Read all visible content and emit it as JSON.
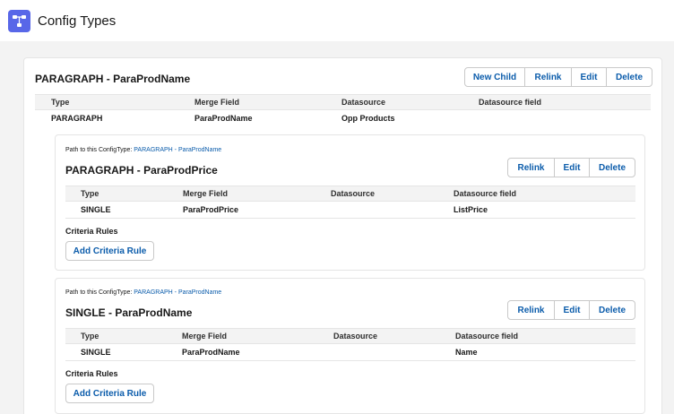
{
  "app": {
    "title": "Config Types",
    "icon": "hierarchy-icon",
    "icon_color": "#5867e8"
  },
  "accent": "#0b5cab",
  "main": {
    "title": "PARAGRAPH - ParaProdName",
    "buttons": {
      "new_child": "New Child",
      "relink": "Relink",
      "edit": "Edit",
      "delete": "Delete"
    },
    "columns": [
      "Type",
      "Merge Field",
      "Datasource",
      "Datasource field"
    ],
    "row": [
      "PARAGRAPH",
      "ParaProdName",
      "Opp Products",
      ""
    ]
  },
  "children": [
    {
      "path_label": "Path to this ConfigType:",
      "path_link": "PARAGRAPH - ParaProdName",
      "title": "PARAGRAPH - ParaProdPrice",
      "buttons": {
        "relink": "Relink",
        "edit": "Edit",
        "delete": "Delete"
      },
      "columns": [
        "Type",
        "Merge Field",
        "Datasource",
        "Datasource field"
      ],
      "row": [
        "SINGLE",
        "ParaProdPrice",
        "",
        "ListPrice"
      ],
      "criteria_label": "Criteria Rules",
      "add_rule": "Add Criteria Rule"
    },
    {
      "path_label": "Path to this ConfigType:",
      "path_link": "PARAGRAPH - ParaProdName",
      "title": "SINGLE - ParaProdName",
      "buttons": {
        "relink": "Relink",
        "edit": "Edit",
        "delete": "Delete"
      },
      "columns": [
        "Type",
        "Merge Field",
        "Datasource",
        "Datasource field"
      ],
      "row": [
        "SINGLE",
        "ParaProdName",
        "",
        "Name"
      ],
      "criteria_label": "Criteria Rules",
      "add_rule": "Add Criteria Rule"
    }
  ]
}
